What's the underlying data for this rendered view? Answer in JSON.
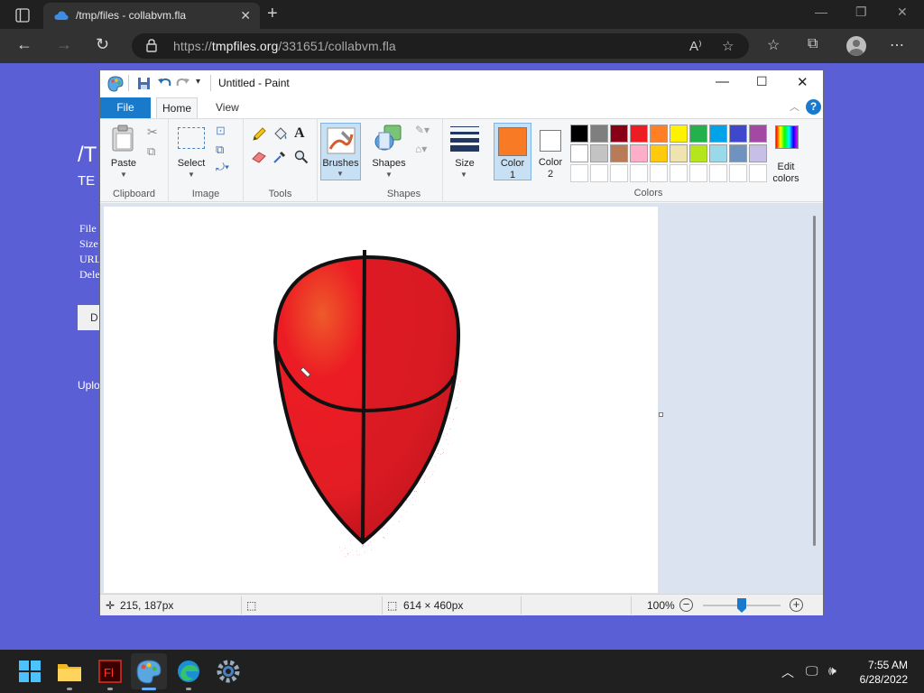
{
  "browser": {
    "tab_title": "/tmp/files - collabvm.fla",
    "url_prefix": "https://",
    "url_domain": "tmpfiles.org",
    "url_path": "/331651/collabvm.fla"
  },
  "webpage": {
    "title": "/T",
    "subtitle": "TE",
    "lines": [
      "File",
      "Size",
      "URL",
      "Dele"
    ],
    "button_label": "D",
    "upload_text": "Uplo"
  },
  "paint": {
    "title": "Untitled - Paint",
    "tabs": {
      "file": "File",
      "home": "Home",
      "view": "View"
    },
    "groups": {
      "clipboard": "Clipboard",
      "image": "Image",
      "tools": "Tools",
      "shapes": "Shapes",
      "colors": "Colors"
    },
    "buttons": {
      "paste": "Paste",
      "select": "Select",
      "brushes": "Brushes",
      "shapes": "Shapes",
      "size": "Size",
      "color1_line1": "Color",
      "color1_line2": "1",
      "color2_line1": "Color",
      "color2_line2": "2",
      "edit_colors_line1": "Edit",
      "edit_colors_line2": "colors"
    },
    "color1": "#f97a24",
    "color2": "#ffffff",
    "palette_row1": [
      "#000000",
      "#7f7f7f",
      "#880015",
      "#ed1c24",
      "#ff7f27",
      "#fff200",
      "#22b14c",
      "#00a2e8",
      "#3f48cc",
      "#a349a4"
    ],
    "palette_row2": [
      "#ffffff",
      "#c3c3c3",
      "#b97a57",
      "#ffaec9",
      "#ffc90e",
      "#efe4b0",
      "#b5e61d",
      "#99d9ea",
      "#7092be",
      "#c8bfe7"
    ],
    "status": {
      "cursor_pos": "215, 187px",
      "canvas_size": "614 × 460px",
      "zoom": "100%"
    }
  },
  "taskbar": {
    "time": "7:55 AM",
    "date": "6/28/2022",
    "apps": [
      "start-icon",
      "file-explorer-icon",
      "flash-icon",
      "paint-icon",
      "edge-icon",
      "settings-icon"
    ]
  }
}
